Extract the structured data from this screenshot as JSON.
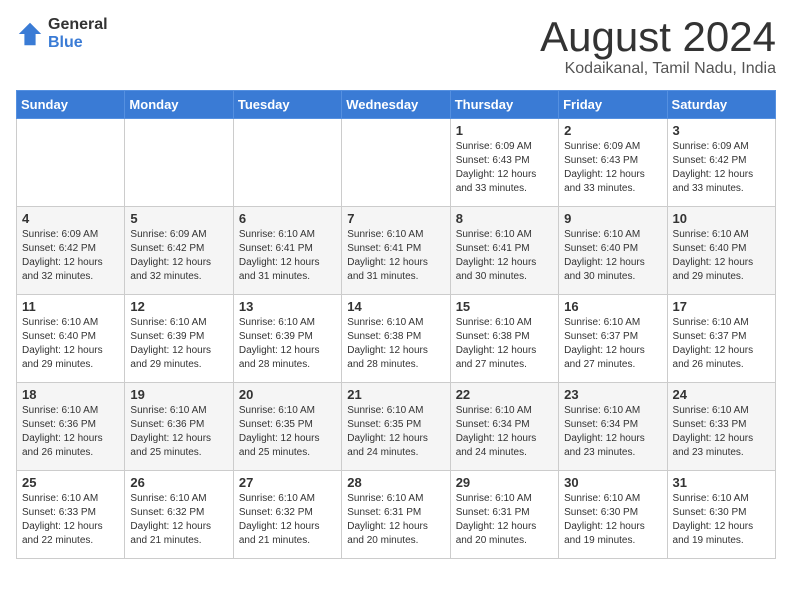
{
  "logo": {
    "general": "General",
    "blue": "Blue"
  },
  "title": {
    "month": "August 2024",
    "location": "Kodaikanal, Tamil Nadu, India"
  },
  "days_header": [
    "Sunday",
    "Monday",
    "Tuesday",
    "Wednesday",
    "Thursday",
    "Friday",
    "Saturday"
  ],
  "weeks": [
    [
      {
        "day": "",
        "info": ""
      },
      {
        "day": "",
        "info": ""
      },
      {
        "day": "",
        "info": ""
      },
      {
        "day": "",
        "info": ""
      },
      {
        "day": "1",
        "info": "Sunrise: 6:09 AM\nSunset: 6:43 PM\nDaylight: 12 hours and 33 minutes."
      },
      {
        "day": "2",
        "info": "Sunrise: 6:09 AM\nSunset: 6:43 PM\nDaylight: 12 hours and 33 minutes."
      },
      {
        "day": "3",
        "info": "Sunrise: 6:09 AM\nSunset: 6:42 PM\nDaylight: 12 hours and 33 minutes."
      }
    ],
    [
      {
        "day": "4",
        "info": "Sunrise: 6:09 AM\nSunset: 6:42 PM\nDaylight: 12 hours and 32 minutes."
      },
      {
        "day": "5",
        "info": "Sunrise: 6:09 AM\nSunset: 6:42 PM\nDaylight: 12 hours and 32 minutes."
      },
      {
        "day": "6",
        "info": "Sunrise: 6:10 AM\nSunset: 6:41 PM\nDaylight: 12 hours and 31 minutes."
      },
      {
        "day": "7",
        "info": "Sunrise: 6:10 AM\nSunset: 6:41 PM\nDaylight: 12 hours and 31 minutes."
      },
      {
        "day": "8",
        "info": "Sunrise: 6:10 AM\nSunset: 6:41 PM\nDaylight: 12 hours and 30 minutes."
      },
      {
        "day": "9",
        "info": "Sunrise: 6:10 AM\nSunset: 6:40 PM\nDaylight: 12 hours and 30 minutes."
      },
      {
        "day": "10",
        "info": "Sunrise: 6:10 AM\nSunset: 6:40 PM\nDaylight: 12 hours and 29 minutes."
      }
    ],
    [
      {
        "day": "11",
        "info": "Sunrise: 6:10 AM\nSunset: 6:40 PM\nDaylight: 12 hours and 29 minutes."
      },
      {
        "day": "12",
        "info": "Sunrise: 6:10 AM\nSunset: 6:39 PM\nDaylight: 12 hours and 29 minutes."
      },
      {
        "day": "13",
        "info": "Sunrise: 6:10 AM\nSunset: 6:39 PM\nDaylight: 12 hours and 28 minutes."
      },
      {
        "day": "14",
        "info": "Sunrise: 6:10 AM\nSunset: 6:38 PM\nDaylight: 12 hours and 28 minutes."
      },
      {
        "day": "15",
        "info": "Sunrise: 6:10 AM\nSunset: 6:38 PM\nDaylight: 12 hours and 27 minutes."
      },
      {
        "day": "16",
        "info": "Sunrise: 6:10 AM\nSunset: 6:37 PM\nDaylight: 12 hours and 27 minutes."
      },
      {
        "day": "17",
        "info": "Sunrise: 6:10 AM\nSunset: 6:37 PM\nDaylight: 12 hours and 26 minutes."
      }
    ],
    [
      {
        "day": "18",
        "info": "Sunrise: 6:10 AM\nSunset: 6:36 PM\nDaylight: 12 hours and 26 minutes."
      },
      {
        "day": "19",
        "info": "Sunrise: 6:10 AM\nSunset: 6:36 PM\nDaylight: 12 hours and 25 minutes."
      },
      {
        "day": "20",
        "info": "Sunrise: 6:10 AM\nSunset: 6:35 PM\nDaylight: 12 hours and 25 minutes."
      },
      {
        "day": "21",
        "info": "Sunrise: 6:10 AM\nSunset: 6:35 PM\nDaylight: 12 hours and 24 minutes."
      },
      {
        "day": "22",
        "info": "Sunrise: 6:10 AM\nSunset: 6:34 PM\nDaylight: 12 hours and 24 minutes."
      },
      {
        "day": "23",
        "info": "Sunrise: 6:10 AM\nSunset: 6:34 PM\nDaylight: 12 hours and 23 minutes."
      },
      {
        "day": "24",
        "info": "Sunrise: 6:10 AM\nSunset: 6:33 PM\nDaylight: 12 hours and 23 minutes."
      }
    ],
    [
      {
        "day": "25",
        "info": "Sunrise: 6:10 AM\nSunset: 6:33 PM\nDaylight: 12 hours and 22 minutes."
      },
      {
        "day": "26",
        "info": "Sunrise: 6:10 AM\nSunset: 6:32 PM\nDaylight: 12 hours and 21 minutes."
      },
      {
        "day": "27",
        "info": "Sunrise: 6:10 AM\nSunset: 6:32 PM\nDaylight: 12 hours and 21 minutes."
      },
      {
        "day": "28",
        "info": "Sunrise: 6:10 AM\nSunset: 6:31 PM\nDaylight: 12 hours and 20 minutes."
      },
      {
        "day": "29",
        "info": "Sunrise: 6:10 AM\nSunset: 6:31 PM\nDaylight: 12 hours and 20 minutes."
      },
      {
        "day": "30",
        "info": "Sunrise: 6:10 AM\nSunset: 6:30 PM\nDaylight: 12 hours and 19 minutes."
      },
      {
        "day": "31",
        "info": "Sunrise: 6:10 AM\nSunset: 6:30 PM\nDaylight: 12 hours and 19 minutes."
      }
    ]
  ]
}
